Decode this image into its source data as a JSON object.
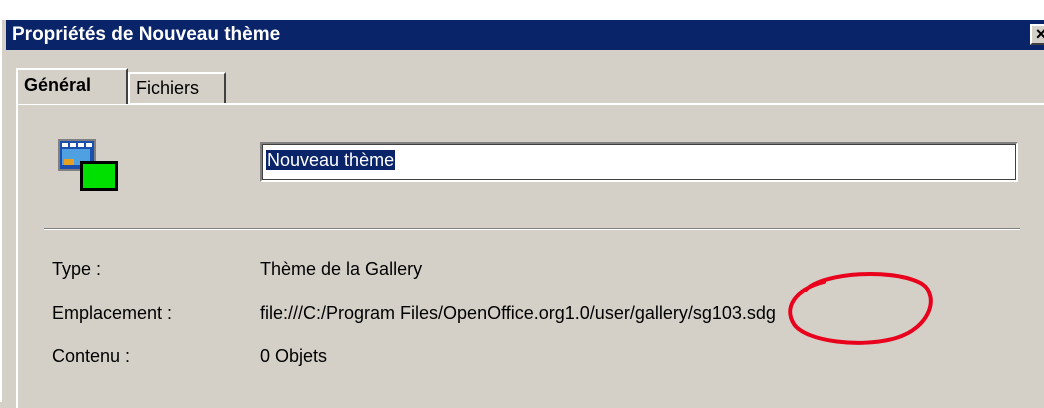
{
  "window": {
    "title": "Propriétés de Nouveau thème",
    "close_glyph": "×"
  },
  "tabs": [
    {
      "label": "Général",
      "active": true
    },
    {
      "label": "Fichiers",
      "active": false
    }
  ],
  "general": {
    "icon": "gallery-theme-icon",
    "name_value": "Nouveau thème",
    "rows": {
      "type": {
        "label": "Type :",
        "value": "Thème de la Gallery"
      },
      "location": {
        "label": "Emplacement :",
        "value": "file:///C:/Program Files/OpenOffice.org1.0/user/gallery/sg103.sdg"
      },
      "content": {
        "label": "Contenu :",
        "value": "0 Objets"
      }
    }
  },
  "colors": {
    "titlebar": "#0a246a",
    "face": "#d4d0c8",
    "annotation": "#e8001c"
  }
}
